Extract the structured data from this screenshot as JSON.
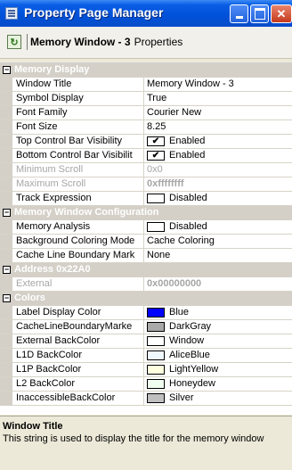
{
  "window": {
    "title": "Property Page Manager"
  },
  "toolbar": {
    "object_name": "Memory Window - 3",
    "object_suffix": "Properties"
  },
  "categories": [
    {
      "label": "Memory Display",
      "toggle": "−",
      "rows": [
        {
          "name": "Window Title",
          "value": "Memory Window - 3",
          "kind": "text",
          "disabled": false
        },
        {
          "name": "Symbol Display",
          "value": "True",
          "kind": "text",
          "disabled": false
        },
        {
          "name": "Font Family",
          "value": "Courier New",
          "kind": "text",
          "disabled": false
        },
        {
          "name": "Font Size",
          "value": "8.25",
          "kind": "text",
          "disabled": false
        },
        {
          "name": "Top Control Bar Visibility",
          "value": "Enabled",
          "kind": "check",
          "checked": true,
          "disabled": false
        },
        {
          "name": "Bottom Control Bar Visibilit",
          "value": "Enabled",
          "kind": "check",
          "checked": true,
          "disabled": false
        },
        {
          "name": "Minimum Scroll",
          "value": "0x0",
          "kind": "text",
          "disabled": true
        },
        {
          "name": "Maximum Scroll",
          "value": "0xffffffff",
          "kind": "text",
          "disabled": true,
          "bold": true
        },
        {
          "name": "Track Expression",
          "value": "Disabled",
          "kind": "check",
          "checked": false,
          "disabled": false
        }
      ]
    },
    {
      "label": "Memory Window Configuration",
      "toggle": "−",
      "rows": [
        {
          "name": "Memory Analysis",
          "value": "Disabled",
          "kind": "check",
          "checked": false,
          "disabled": false
        },
        {
          "name": "Background Coloring Mode",
          "value": "Cache Coloring",
          "kind": "text",
          "disabled": false
        },
        {
          "name": "Cache Line Boundary Mark",
          "value": "None",
          "kind": "text",
          "disabled": false
        }
      ]
    },
    {
      "label": "Address 0x22A0",
      "toggle": "−",
      "rows": [
        {
          "name": "External",
          "value": "0x00000000",
          "kind": "text",
          "disabled": true,
          "bold": true
        }
      ]
    },
    {
      "label": "Colors",
      "toggle": "−",
      "rows": [
        {
          "name": "Label Display Color",
          "value": "Blue",
          "kind": "color",
          "color": "#0000ff"
        },
        {
          "name": "CacheLineBoundaryMarke",
          "value": "DarkGray",
          "kind": "color",
          "color": "#a9a9a9"
        },
        {
          "name": "External BackColor",
          "value": "Window",
          "kind": "color",
          "color": "#ffffff"
        },
        {
          "name": "L1D BackColor",
          "value": "AliceBlue",
          "kind": "color",
          "color": "#f0f8ff"
        },
        {
          "name": "L1P BackColor",
          "value": "LightYellow",
          "kind": "color",
          "color": "#ffffe0"
        },
        {
          "name": "L2 BackColor",
          "value": "Honeydew",
          "kind": "color",
          "color": "#f0fff0"
        },
        {
          "name": "InaccessibleBackColor",
          "value": "Silver",
          "kind": "color",
          "color": "#c0c0c0"
        }
      ]
    }
  ],
  "description": {
    "title": "Window Title",
    "text": "This string is used to display the title for the memory window"
  },
  "icons": {
    "app": "property-page-icon",
    "refresh": "refresh-icon",
    "minimize": "minimize-icon",
    "maximize": "maximize-icon",
    "close": "close-icon"
  },
  "colors": {
    "titlebar": "#0050d8",
    "category_bg": "#d4d0c8",
    "disabled_text": "#a6a6a6"
  }
}
